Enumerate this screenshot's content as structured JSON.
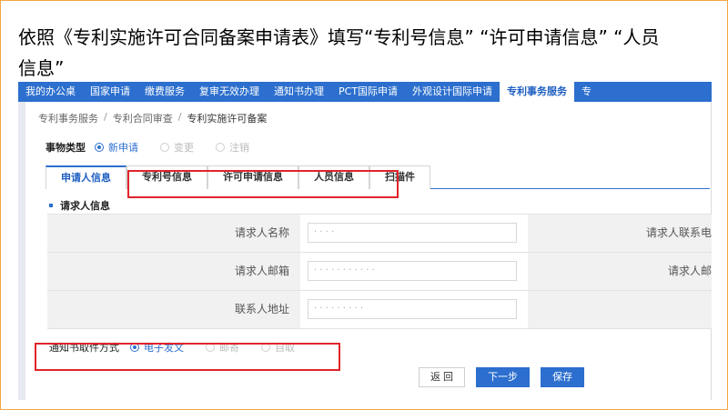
{
  "caption": "依照《专利实施许可合同备案申请表》填写“专利号信息”  “许可申请信息”  “人员信息”",
  "topnav": {
    "items": [
      "我的办公桌",
      "国家申请",
      "缴费服务",
      "复审无效办理",
      "通知书办理",
      "PCT国际申请",
      "外观设计国际申请",
      "专利事务服务",
      "专"
    ],
    "active_index": 7
  },
  "breadcrumb": [
    "专利事务服务",
    "专利合同审查",
    "专利实施许可备案"
  ],
  "matter": {
    "label": "事物类型",
    "options": [
      "新申请",
      "变更",
      "注销"
    ],
    "selected_index": 0
  },
  "tabs": [
    "申请人信息",
    "专利号信息",
    "许可申请信息",
    "人员信息",
    "扫描件"
  ],
  "active_tab_index": 0,
  "section_title": "请求人信息",
  "form": {
    "rows": [
      {
        "label": "请求人名称",
        "value": "· · · ·",
        "right_label": "请求人联系电"
      },
      {
        "label": "请求人邮箱",
        "value": "· · · · · · · · · · ·",
        "right_label": "请求人邮"
      },
      {
        "label": "联系人地址",
        "value": "· · · · · · · · ·",
        "right_label": ""
      }
    ]
  },
  "notice": {
    "label": "通知书取件方式",
    "options": [
      "电子发文",
      "邮寄",
      "自取"
    ],
    "selected_index": 0
  },
  "actions": {
    "back": "返 回",
    "next": "下一步",
    "save": "保存"
  },
  "colors": {
    "nav_bg": "#2c6fce",
    "highlight": "#e0242b",
    "slide_border": "#f0a640"
  }
}
